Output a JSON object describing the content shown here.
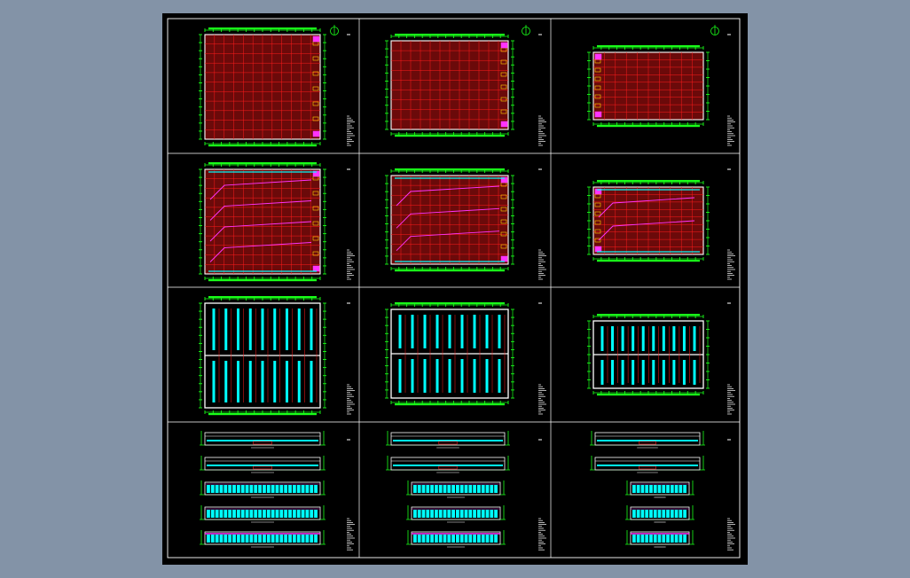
{
  "viewer": {
    "background_color": "#8393a7",
    "canvas_color": "#000000"
  },
  "sheet": {
    "grid_rows": 4,
    "grid_cols": 3,
    "border_color": "#ffffff"
  },
  "colors": {
    "grid_red": "#ff1c1c",
    "dim_green": "#19ff19",
    "outline_white": "#ffffff",
    "fill_cyan": "#00ffff",
    "route_magenta": "#ff33ff",
    "accent_yellow": "#ffd400",
    "plan_fill": "#6b0a0a"
  },
  "panels": [
    {
      "name": "plan-large-1",
      "type": "floor-plan",
      "variant": "large"
    },
    {
      "name": "plan-medium-1",
      "type": "floor-plan",
      "variant": "medium"
    },
    {
      "name": "plan-small-1",
      "type": "floor-plan",
      "variant": "small"
    },
    {
      "name": "route-large",
      "type": "route-plan",
      "variant": "large"
    },
    {
      "name": "route-medium",
      "type": "route-plan",
      "variant": "medium"
    },
    {
      "name": "route-small",
      "type": "route-plan",
      "variant": "small"
    },
    {
      "name": "roof-large",
      "type": "roof-plan",
      "variant": "large"
    },
    {
      "name": "roof-medium",
      "type": "roof-plan",
      "variant": "medium"
    },
    {
      "name": "roof-small",
      "type": "roof-plan",
      "variant": "small"
    },
    {
      "name": "elev-large",
      "type": "elevations",
      "variant": "large"
    },
    {
      "name": "elev-medium",
      "type": "elevations",
      "variant": "medium"
    },
    {
      "name": "elev-small",
      "type": "elevations",
      "variant": "small"
    }
  ]
}
